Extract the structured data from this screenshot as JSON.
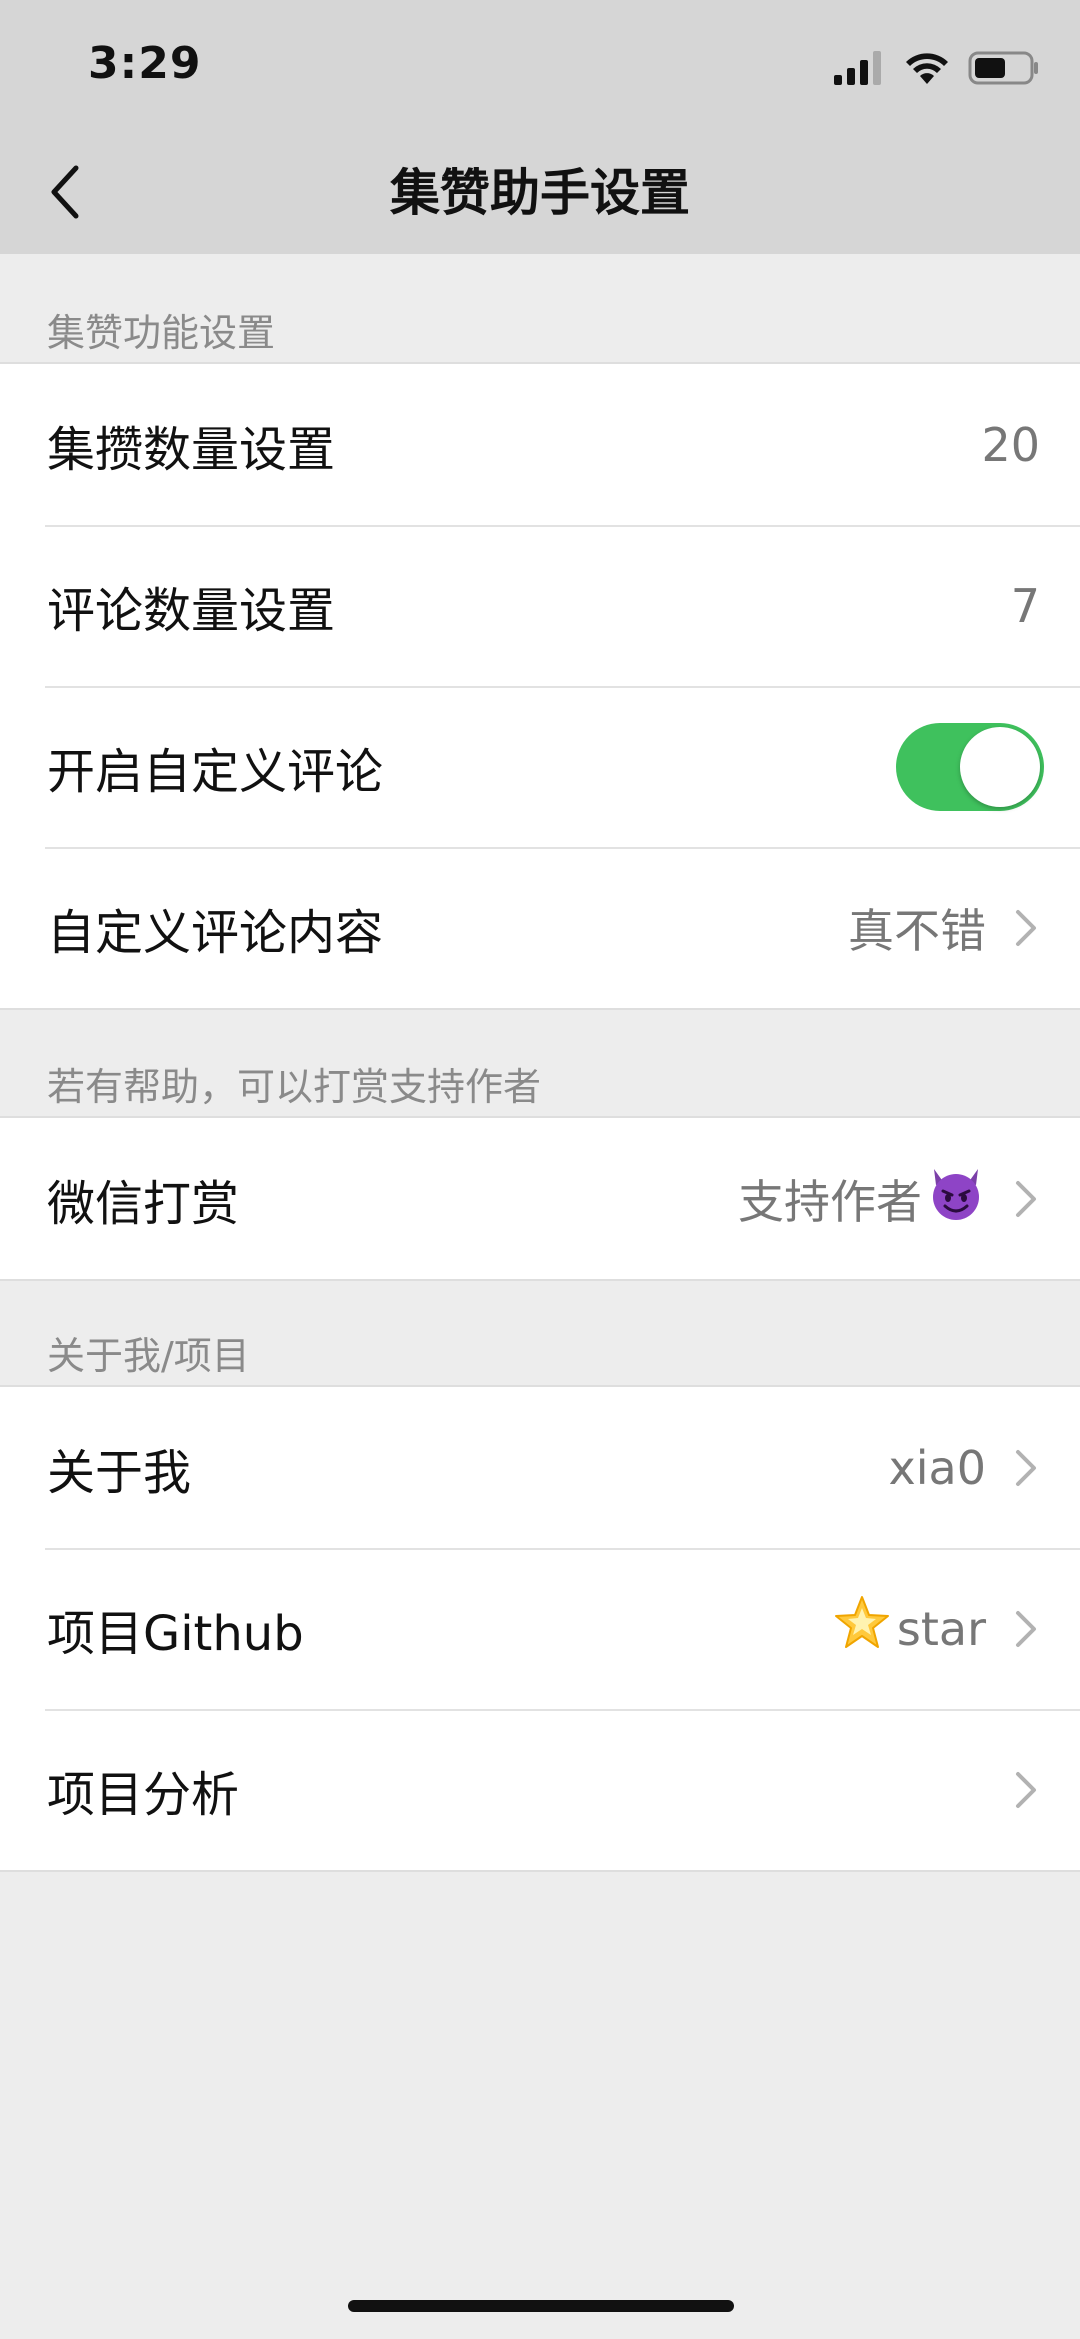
{
  "status_bar": {
    "time": "3:29"
  },
  "nav": {
    "title": "集赞助手设置"
  },
  "sections": [
    {
      "header": "集赞功能设置",
      "rows": [
        {
          "label": "集攒数量设置",
          "value": "20"
        },
        {
          "label": "评论数量设置",
          "value": "7"
        },
        {
          "label": "开启自定义评论",
          "toggle_on": true
        },
        {
          "label": "自定义评论内容",
          "value": "真不错"
        }
      ]
    },
    {
      "header": "若有帮助，可以打赏支持作者",
      "rows": [
        {
          "label": "微信打赏",
          "value": "支持作者",
          "emoji": "devil-face-icon"
        }
      ]
    },
    {
      "header": "关于我/项目",
      "rows": [
        {
          "label": "关于我",
          "value": "xia0"
        },
        {
          "label": "项目Github",
          "value": "star",
          "emoji": "star-icon"
        },
        {
          "label": "项目分析",
          "value": ""
        }
      ]
    }
  ],
  "colors": {
    "toggle_on": "#3fc15d",
    "background": "#ededed",
    "header_bar": "#d6d6d6"
  }
}
